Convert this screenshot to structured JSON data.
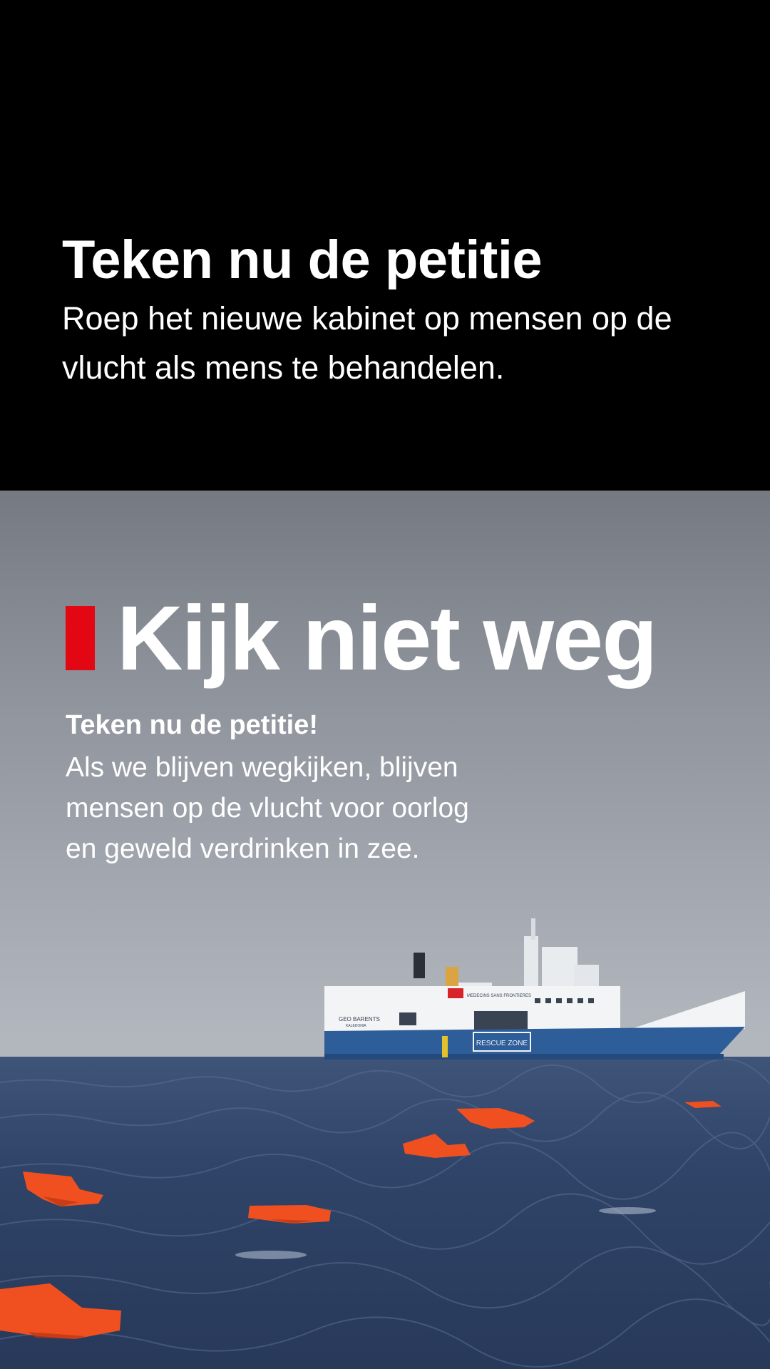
{
  "top": {
    "title": "Teken nu de petitie",
    "subtitle": "Roep het nieuwe kabinet op mensen op de vlucht als mens te behandelen."
  },
  "campaign": {
    "headline": "Kijk niet weg",
    "cta_bold": "Teken nu de petitie!",
    "body_lines": [
      "Als we blijven wegkijken, blijven",
      "mensen op de vlucht voor oorlog",
      "en geweld verdrinken in zee."
    ],
    "accent_color": "#e30613"
  },
  "photo": {
    "ship_name": "GEO BARENTS",
    "ship_port": "KALEDONIA",
    "ship_sign": "RESCUE ZONE",
    "ship_logo_text": "MEDECINS SANS FRONTIERES"
  }
}
